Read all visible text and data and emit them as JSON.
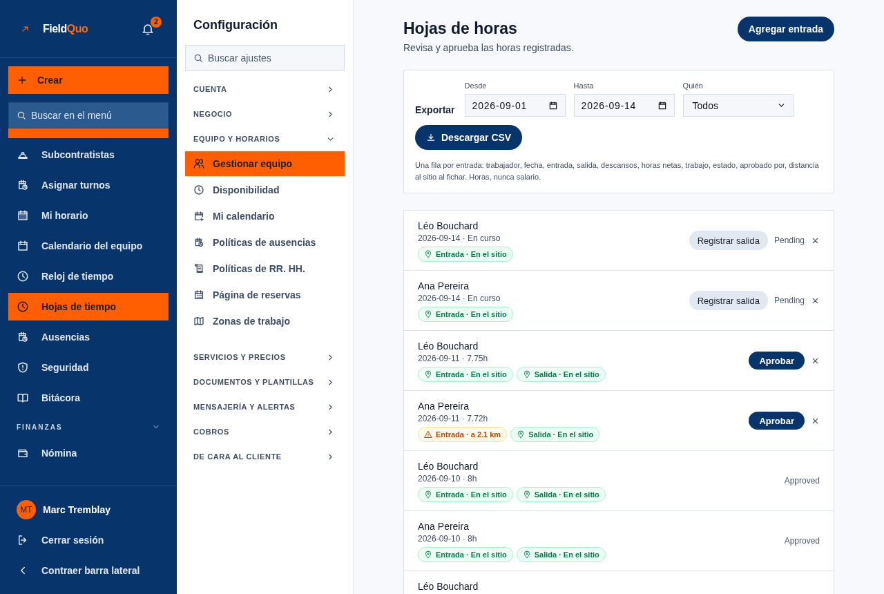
{
  "brand": {
    "name": "Field",
    "accent": "Quo"
  },
  "notifications": {
    "count": "2"
  },
  "create_button": "Crear",
  "menu_search": {
    "placeholder": "Buscar en el menú"
  },
  "nav": [
    {
      "kind": "item",
      "label": "Subcontratistas",
      "selected": false
    },
    {
      "kind": "item",
      "label": "Asignar turnos",
      "selected": false
    },
    {
      "kind": "item",
      "label": "Mi horario",
      "selected": false
    },
    {
      "kind": "item",
      "label": "Calendario del equipo",
      "selected": false
    },
    {
      "kind": "item",
      "label": "Reloj de tiempo",
      "selected": false
    },
    {
      "kind": "item",
      "label": "Hojas de tiempo",
      "selected": true
    },
    {
      "kind": "item",
      "label": "Ausencias",
      "selected": false
    },
    {
      "kind": "item",
      "label": "Seguridad",
      "selected": false
    },
    {
      "kind": "item",
      "label": "Bitácora",
      "selected": false
    },
    {
      "kind": "section",
      "label": "FINANZAS",
      "expanded": true
    },
    {
      "kind": "item",
      "label": "Nómina",
      "selected": false
    }
  ],
  "user": {
    "initials": "MT",
    "name": "Marc Tremblay"
  },
  "footer_links": [
    "Cerrar sesión",
    "Contraer barra lateral"
  ],
  "settings": {
    "title": "Configuración",
    "search": {
      "placeholder": "Buscar ajustes"
    },
    "sections": [
      {
        "title": "CUENTA",
        "expanded": false
      },
      {
        "title": "NEGOCIO",
        "expanded": false
      },
      {
        "title": "EQUIPO Y HORARIOS",
        "expanded": true,
        "items": [
          {
            "label": "Gestionar equipo",
            "selected": true
          },
          {
            "label": "Disponibilidad",
            "selected": false
          },
          {
            "label": "Mi calendario",
            "selected": false
          },
          {
            "label": "Políticas de ausencias",
            "selected": false
          },
          {
            "label": "Políticas de RR. HH.",
            "selected": false
          },
          {
            "label": "Página de reservas",
            "selected": false
          },
          {
            "label": "Zonas de trabajo",
            "selected": false
          }
        ]
      },
      {
        "title": "SERVICIOS Y PRECIOS",
        "expanded": false
      },
      {
        "title": "DOCUMENTOS Y PLANTILLAS",
        "expanded": false
      },
      {
        "title": "MENSAJERÍA Y ALERTAS",
        "expanded": false
      },
      {
        "title": "COBROS",
        "expanded": false
      },
      {
        "title": "DE CARA AL CLIENTE",
        "expanded": false
      }
    ]
  },
  "page": {
    "title": "Hojas de horas",
    "subtitle": "Revisa y aprueba las horas registradas.",
    "add_button": "Agregar entrada"
  },
  "export": {
    "label": "Exportar",
    "fields": [
      {
        "label": "Desde",
        "kind": "date",
        "value": "2026-09-01"
      },
      {
        "label": "Hasta",
        "kind": "date",
        "value": "2026-09-14"
      },
      {
        "label": "Quién",
        "kind": "select",
        "value": "Todos"
      }
    ],
    "button": "Descargar CSV",
    "note": "Una fila por entrada: trabajador, fecha, entrada, salida, descansos, horas netas, trabajo, estado, aprobado por, distancia al sitio al fichar. Horas, nunca salario."
  },
  "entries": [
    {
      "name": "Léo Bouchard",
      "meta": "2026-09-14 · En curso",
      "tags": [
        {
          "kind": "ok",
          "text": "Entrada · En el sitio"
        }
      ],
      "action": {
        "kind": "clockout",
        "label": "Registrar salida"
      },
      "status": "Pending",
      "dismissible": true
    },
    {
      "name": "Ana Pereira",
      "meta": "2026-09-14 · En curso",
      "tags": [
        {
          "kind": "ok",
          "text": "Entrada · En el sitio"
        }
      ],
      "action": {
        "kind": "clockout",
        "label": "Registrar salida"
      },
      "status": "Pending",
      "dismissible": true
    },
    {
      "name": "Léo Bouchard",
      "meta": "2026-09-11 · 7.75h",
      "tags": [
        {
          "kind": "ok",
          "text": "Entrada · En el sitio"
        },
        {
          "kind": "ok",
          "text": "Salida · En el sitio"
        }
      ],
      "action": {
        "kind": "approve",
        "label": "Aprobar"
      },
      "dismissible": true
    },
    {
      "name": "Ana Pereira",
      "meta": "2026-09-11 · 7.72h",
      "tags": [
        {
          "kind": "warn",
          "text": "Entrada · a 2.1 km"
        },
        {
          "kind": "ok",
          "text": "Salida · En el sitio"
        }
      ],
      "action": {
        "kind": "approve",
        "label": "Aprobar"
      },
      "dismissible": true
    },
    {
      "name": "Léo Bouchard",
      "meta": "2026-09-10 · 8h",
      "tags": [
        {
          "kind": "ok",
          "text": "Entrada · En el sitio"
        },
        {
          "kind": "ok",
          "text": "Salida · En el sitio"
        }
      ],
      "status": "Approved",
      "dismissible": false
    },
    {
      "name": "Ana Pereira",
      "meta": "2026-09-10 · 8h",
      "tags": [
        {
          "kind": "ok",
          "text": "Entrada · En el sitio"
        },
        {
          "kind": "ok",
          "text": "Salida · En el sitio"
        }
      ],
      "status": "Approved",
      "dismissible": false
    },
    {
      "name": "Léo Bouchard",
      "dismissible": false
    }
  ]
}
